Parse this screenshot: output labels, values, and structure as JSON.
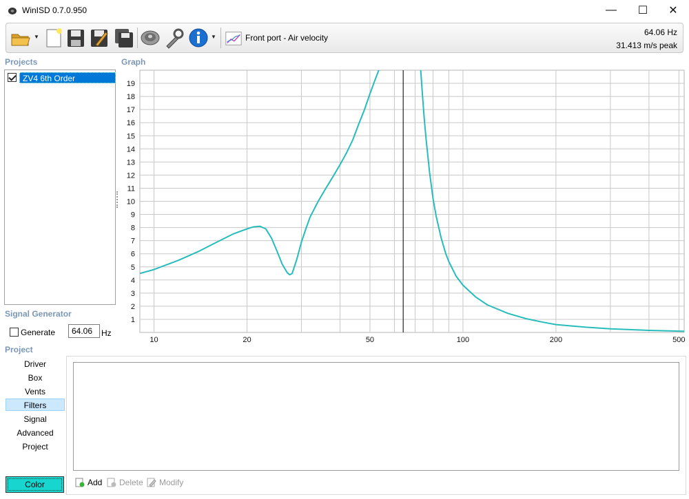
{
  "window": {
    "title": "WinISD 0.7.0.950",
    "min_glyph": "—",
    "max_glyph": "☐",
    "close_glyph": "✕"
  },
  "toolbar": {
    "icons": [
      "open-folder-icon",
      "new-document-icon",
      "save-icon",
      "save-as-icon",
      "save-all-icon",
      "driver-icon",
      "wrench-icon",
      "info-icon"
    ],
    "graph_selector": {
      "label": "Front port - Air velocity",
      "icon": "graph-icon"
    },
    "readout": {
      "frequency": "64.06 Hz",
      "value": "31.413 m/s peak"
    }
  },
  "projects": {
    "heading": "Projects",
    "items": [
      {
        "label": "ZV4 6th Order",
        "checked": true
      }
    ]
  },
  "signal_generator": {
    "heading": "Signal Generator",
    "generate_label": "Generate",
    "frequency_value": "64.06",
    "unit": "Hz"
  },
  "project_nav": {
    "heading": "Project",
    "items": [
      "Driver",
      "Box",
      "Vents",
      "Filters",
      "Signal",
      "Advanced",
      "Project"
    ],
    "active": "Filters"
  },
  "filters": {
    "add_label": "Add",
    "delete_label": "Delete",
    "modify_label": "Modify"
  },
  "color_button": {
    "label": "Color",
    "color": "#16d6cf"
  },
  "graph": {
    "heading": "Graph"
  },
  "chart_data": {
    "type": "line",
    "x_scale": "log",
    "xlim": [
      9,
      520
    ],
    "ylim": [
      0,
      20
    ],
    "x_tick_labels": [
      10,
      20,
      50,
      100,
      200,
      500
    ],
    "x_gridlines": [
      10,
      20,
      30,
      40,
      50,
      60,
      70,
      80,
      90,
      100,
      200,
      300,
      400,
      500
    ],
    "y_tick_labels": [
      1,
      2,
      3,
      4,
      5,
      6,
      7,
      8,
      9,
      10,
      11,
      12,
      13,
      14,
      15,
      16,
      17,
      18,
      19
    ],
    "grid": true,
    "cursor_x": 64.06,
    "line_color": "#26bcbc",
    "series": [
      {
        "x": [
          9,
          10,
          12,
          14,
          16,
          18,
          20,
          21,
          22,
          23,
          24,
          25,
          26,
          27,
          27.5,
          28,
          29,
          30,
          31,
          32,
          34,
          36,
          38,
          40,
          42,
          44,
          46,
          48,
          50,
          52,
          54,
          55
        ],
        "y": [
          4.5,
          4.8,
          5.5,
          6.2,
          6.9,
          7.5,
          7.9,
          8.05,
          8.1,
          7.9,
          7.2,
          6.2,
          5.2,
          4.55,
          4.4,
          4.5,
          5.6,
          6.9,
          7.9,
          8.8,
          10.0,
          11.0,
          11.9,
          12.8,
          13.7,
          14.7,
          15.9,
          17.0,
          18.2,
          19.3,
          20.3,
          21
        ]
      },
      {
        "x": [
          72,
          73,
          74,
          75,
          76,
          78,
          80,
          82,
          85,
          88,
          90,
          95,
          100,
          110,
          120,
          140,
          160,
          180,
          200,
          250,
          300,
          400,
          500,
          520
        ],
        "y": [
          21,
          20.0,
          18.0,
          16.2,
          14.7,
          12.2,
          10.2,
          8.8,
          7.2,
          6.0,
          5.4,
          4.3,
          3.6,
          2.7,
          2.1,
          1.45,
          1.05,
          0.8,
          0.6,
          0.4,
          0.28,
          0.16,
          0.1,
          0.09
        ]
      }
    ]
  }
}
